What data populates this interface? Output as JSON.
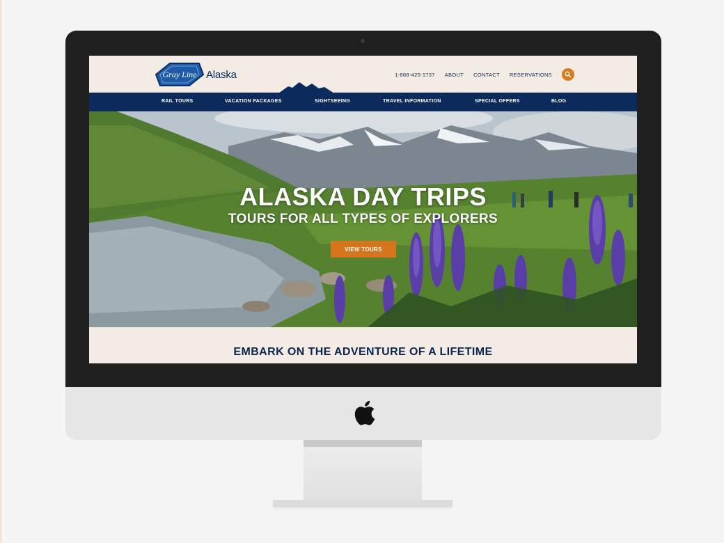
{
  "brand": {
    "logo_badge_text": "Gray Line",
    "logo_text": "Alaska"
  },
  "utility_nav": {
    "phone": "1-888-425-1737",
    "about": "ABOUT",
    "contact": "CONTACT",
    "reservations": "RESERVATIONS",
    "search_icon": "search-icon"
  },
  "main_nav": {
    "items": [
      {
        "label": "RAIL TOURS"
      },
      {
        "label": "VACATION PACKAGES"
      },
      {
        "label": "SIGHTSEEING"
      },
      {
        "label": "TRAVEL INFORMATION"
      },
      {
        "label": "SPECIAL OFFERS"
      },
      {
        "label": "BLOG"
      }
    ]
  },
  "hero": {
    "title": "ALASKA DAY TRIPS",
    "subtitle": "TOURS FOR ALL TYPES OF EXPLORERS",
    "cta_label": "VIEW TOURS"
  },
  "section": {
    "heading": "EMBARK ON THE ADVENTURE OF A LIFETIME"
  },
  "device": {
    "brand_icon": "apple-icon"
  },
  "colors": {
    "navy": "#0c2b5c",
    "accent_orange": "#d6761c",
    "header_bg": "#f3ece4"
  }
}
